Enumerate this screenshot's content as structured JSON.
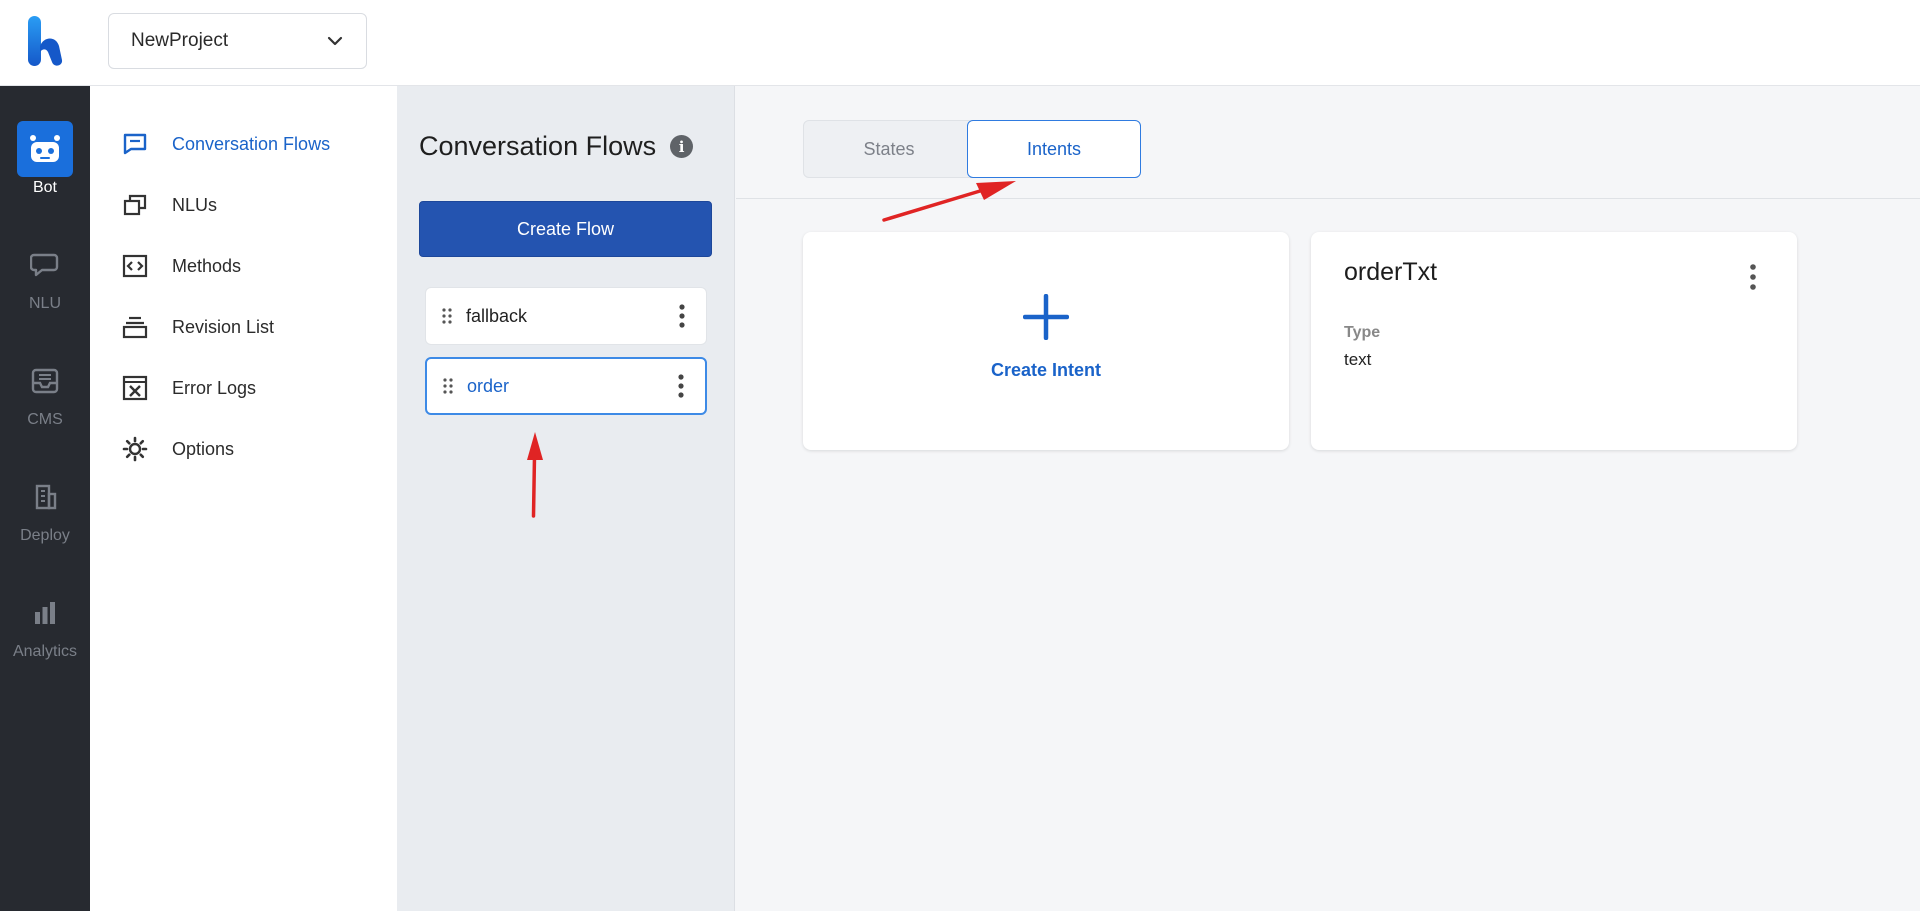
{
  "header": {
    "project_name": "NewProject"
  },
  "rail": {
    "items": [
      {
        "label": "Bot",
        "icon": "robot-icon",
        "active": true
      },
      {
        "label": "NLU",
        "icon": "chat-bubble-icon",
        "active": false
      },
      {
        "label": "CMS",
        "icon": "inbox-icon",
        "active": false
      },
      {
        "label": "Deploy",
        "icon": "building-icon",
        "active": false
      },
      {
        "label": "Analytics",
        "icon": "bar-chart-icon",
        "active": false
      }
    ]
  },
  "subnav": {
    "items": [
      {
        "label": "Conversation Flows",
        "icon": "message-square-icon",
        "active": true
      },
      {
        "label": "NLUs",
        "icon": "copy-icon",
        "active": false
      },
      {
        "label": "Methods",
        "icon": "code-box-icon",
        "active": false
      },
      {
        "label": "Revision List",
        "icon": "stack-icon",
        "active": false
      },
      {
        "label": "Error Logs",
        "icon": "x-box-icon",
        "active": false
      },
      {
        "label": "Options",
        "icon": "gear-icon",
        "active": false
      }
    ]
  },
  "flows": {
    "title": "Conversation Flows",
    "create_label": "Create Flow",
    "items": [
      {
        "name": "fallback",
        "active": false
      },
      {
        "name": "order",
        "active": true
      }
    ]
  },
  "main": {
    "tabs": [
      {
        "label": "States",
        "active": false
      },
      {
        "label": "Intents",
        "active": true
      }
    ],
    "create_intent_label": "Create Intent",
    "intents": [
      {
        "name": "orderTxt",
        "type_label": "Type",
        "type_value": "text"
      }
    ]
  },
  "colors": {
    "accent": "#1a63c9",
    "primary_button": "#2454b0",
    "rail_bg": "#272a30",
    "annotation_arrow": "#e02424"
  }
}
